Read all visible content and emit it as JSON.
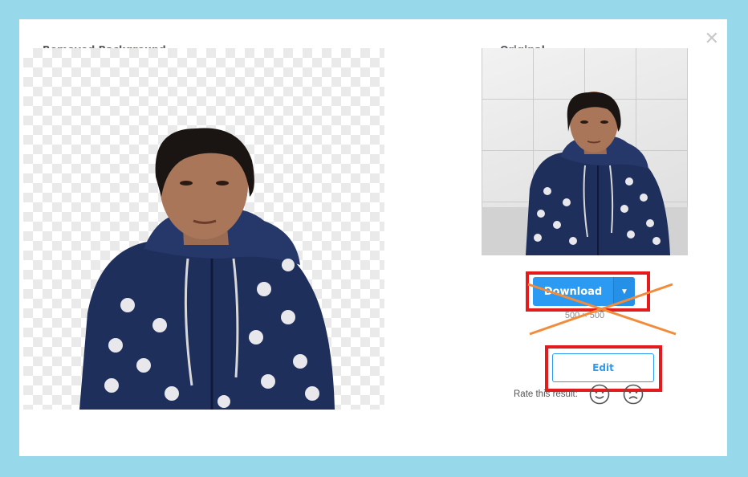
{
  "modal": {
    "close_glyph": "✕",
    "removed_heading": "Removed Background",
    "original_heading": "Original"
  },
  "actions": {
    "download_label": "Download",
    "size_text": "500 × 500",
    "edit_label": "Edit"
  },
  "rating": {
    "label": "Rate this result:",
    "positive_icon": "smiley-face-icon",
    "negative_icon": "sad-face-icon"
  },
  "colors": {
    "page_background": "#97d8ea",
    "accent_blue": "#2b9af3",
    "annotation_red": "#e21c1c",
    "annotation_orange": "#f28c3a"
  }
}
